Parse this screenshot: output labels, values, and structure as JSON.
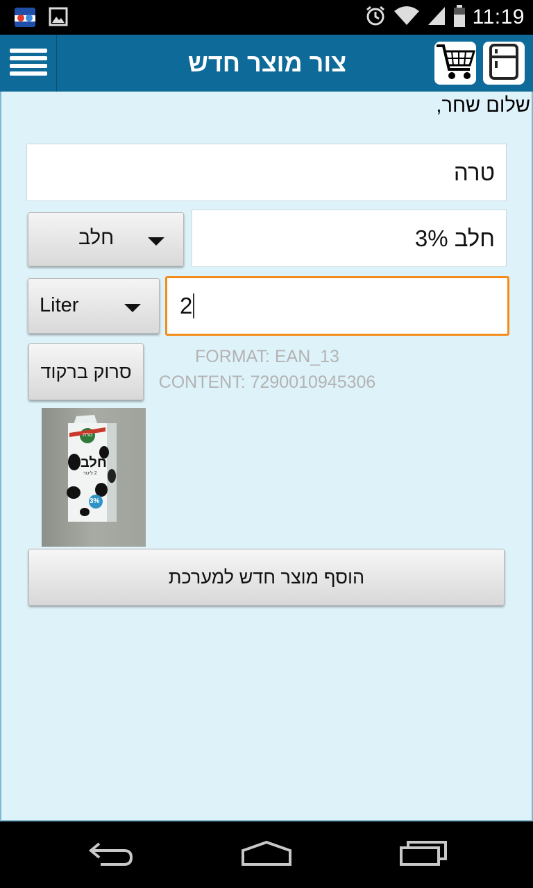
{
  "status_bar": {
    "time": "11:19",
    "left_icons": [
      "app-notification-icon",
      "image-notification-icon"
    ],
    "right_icons": [
      "alarm-icon",
      "wifi-icon",
      "signal-icon",
      "battery-icon"
    ]
  },
  "action_bar": {
    "title": "צור מוצר חדש",
    "menu_icon": "hamburger-menu-icon",
    "cart_icon": "shopping-cart-icon",
    "fridge_icon": "fridge-icon",
    "color": "#0e6a98"
  },
  "form": {
    "greeting": "שלום שחר,",
    "manufacturer_value": "טרה",
    "product_name_value": "חלב 3%",
    "category_selected": "חלב",
    "quantity_value": "2",
    "unit_selected": "Liter",
    "scan_button_label": "סרוק ברקוד",
    "scan_format": "FORMAT: EAN_13",
    "scan_content": "CONTENT: 7290010945306",
    "product_image": {
      "brand": "טרה",
      "label": "חלב",
      "sublabel": "2 ליטר",
      "percent": "3%"
    },
    "submit_button_label": "הוסף מוצר חדש למערכת"
  },
  "nav_bar": {
    "icons": [
      "back-icon",
      "home-icon",
      "recent-apps-icon"
    ]
  },
  "colors": {
    "content_bg": "#def2f9",
    "focus_border": "#f38c1d"
  }
}
